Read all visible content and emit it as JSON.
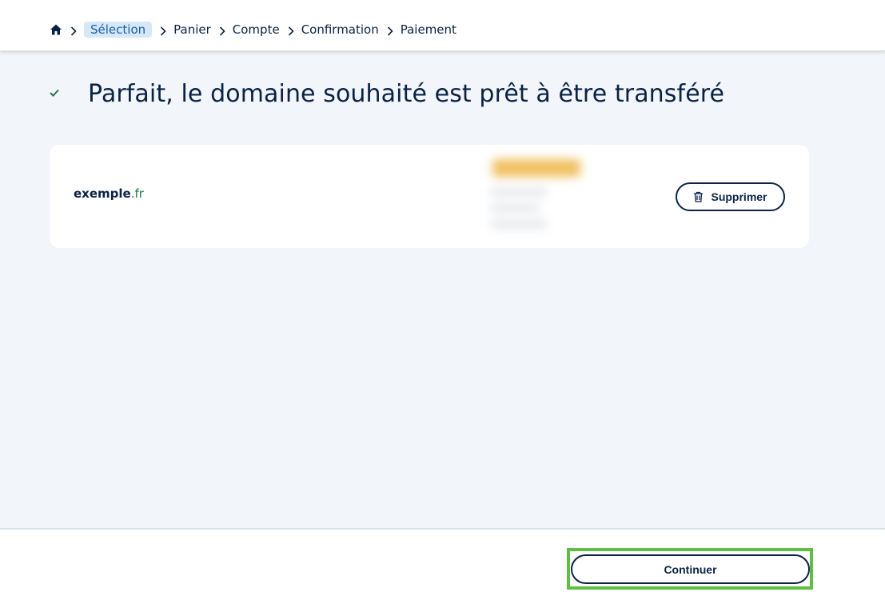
{
  "breadcrumb": {
    "home_icon": "home-icon",
    "items": [
      {
        "label": "Sélection",
        "active": true
      },
      {
        "label": "Panier"
      },
      {
        "label": "Compte"
      },
      {
        "label": "Confirmation"
      },
      {
        "label": "Paiement"
      }
    ]
  },
  "header": {
    "check_icon": "check-icon",
    "title": "Parfait, le domaine souhaité est prêt à être transféré"
  },
  "domain_card": {
    "name": "exemple",
    "tld": ".fr",
    "delete_label": "Supprimer",
    "delete_icon": "trash-icon"
  },
  "footer": {
    "continue_label": "Continuer"
  },
  "colors": {
    "navy": "#0a2244",
    "active_crumb_bg": "#d7e7f7",
    "active_crumb_text": "#1860a8",
    "tld_green": "#1f7a4a",
    "highlight_green": "#5fbf45",
    "page_bg": "#f2f5f9"
  }
}
